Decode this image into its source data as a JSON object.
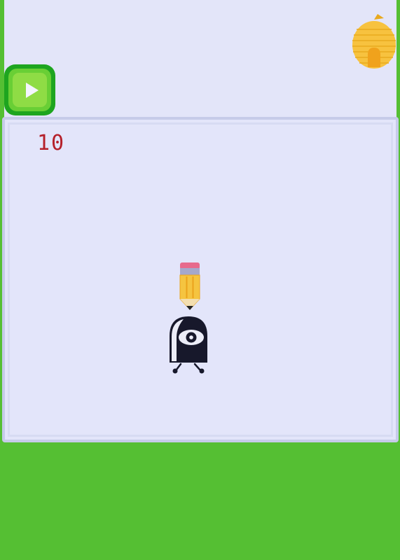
{
  "game": {
    "score": "10",
    "play_button": "play",
    "colors": {
      "ground": "#55bf33",
      "sky": "#e3e5f9",
      "stage": "#e3e5fa",
      "stage_border": "#c6cbe9",
      "score_text": "#b5202a",
      "play_button": "#1ea51f",
      "hive": "#f7c23f"
    },
    "icons": {
      "play": "play-icon",
      "hive": "beehive-icon",
      "pencil": "pencil-icon",
      "character": "one-eyed-character-icon"
    }
  }
}
